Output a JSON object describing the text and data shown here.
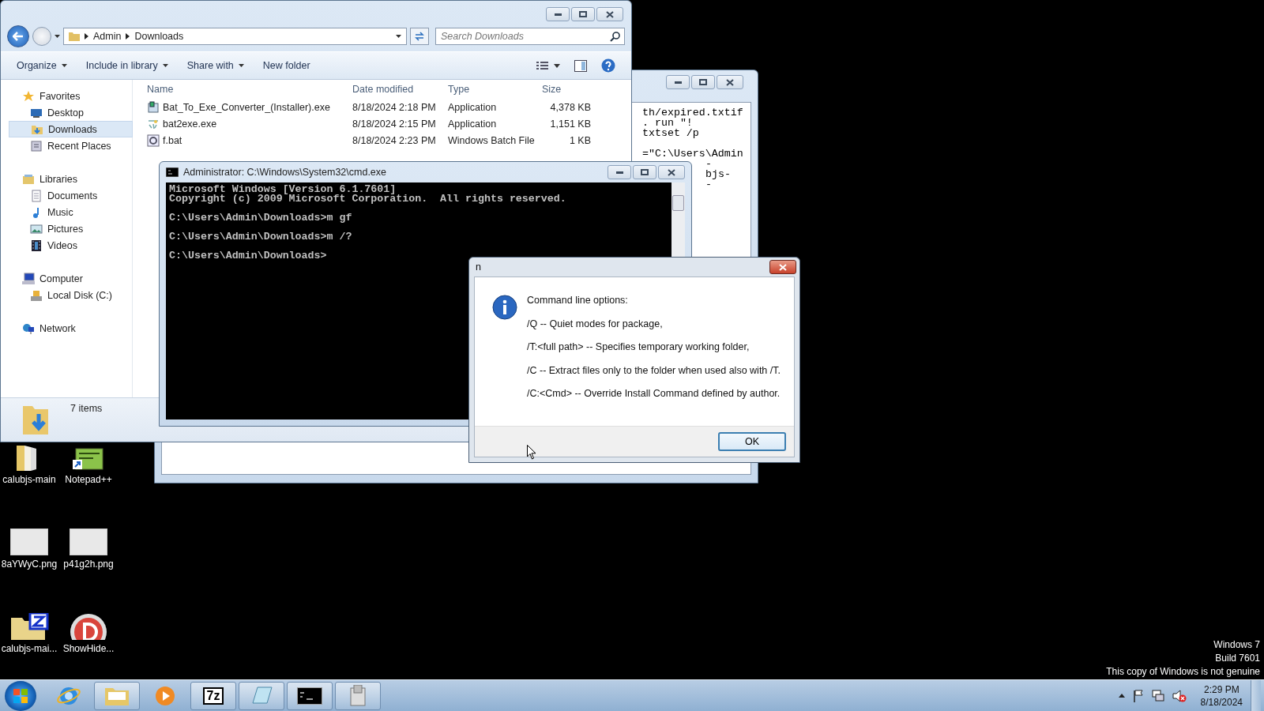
{
  "explorer": {
    "breadcrumb": [
      "Admin",
      "Downloads"
    ],
    "search": {
      "placeholder": "Search Downloads"
    },
    "toolbar": [
      {
        "label": "Organize",
        "menu": true
      },
      {
        "label": "Include in library",
        "menu": true
      },
      {
        "label": "Share with",
        "menu": true
      },
      {
        "label": "New folder",
        "menu": false
      }
    ],
    "columns": [
      "Name",
      "Date modified",
      "Type",
      "Size"
    ],
    "files": [
      {
        "kind": "installer",
        "name": "Bat_To_Exe_Converter_(Installer).exe",
        "date": "8/18/2024 2:18 PM",
        "type": "Application",
        "size": "4,378 KB"
      },
      {
        "kind": "app",
        "name": "bat2exe.exe",
        "date": "8/18/2024 2:15 PM",
        "type": "Application",
        "size": "1,151 KB"
      },
      {
        "kind": "batch",
        "name": "f.bat",
        "date": "8/18/2024 2:23 PM",
        "type": "Windows Batch File",
        "size": "1 KB"
      }
    ],
    "sidebar": [
      {
        "kind": "favorites",
        "label": "Favorites",
        "selected": false,
        "children": [
          {
            "kind": "desktop",
            "label": "Desktop",
            "selected": false
          },
          {
            "kind": "downloads",
            "label": "Downloads",
            "selected": true
          },
          {
            "kind": "recent",
            "label": "Recent Places",
            "selected": false
          }
        ]
      },
      {
        "kind": "libraries",
        "label": "Libraries",
        "selected": false,
        "children": [
          {
            "kind": "documents",
            "label": "Documents",
            "selected": false
          },
          {
            "kind": "music",
            "label": "Music",
            "selected": false
          },
          {
            "kind": "pictures",
            "label": "Pictures",
            "selected": false
          },
          {
            "kind": "videos",
            "label": "Videos",
            "selected": false
          }
        ]
      },
      {
        "kind": "computer",
        "label": "Computer",
        "selected": false,
        "children": [
          {
            "kind": "disk",
            "label": "Local Disk (C:)",
            "selected": false
          }
        ]
      },
      {
        "kind": "network",
        "label": "Network",
        "selected": false
      }
    ],
    "status": "7 items"
  },
  "back_window": {
    "blocks": [
      {
        "kind": "full",
        "lines": [
          "th/expired.txtif",
          ". run \"!",
          "txtset /p"
        ]
      },
      {
        "kind": "full",
        "lines": [
          "=\"C:\\Users\\Admin"
        ]
      },
      {
        "kind": "tail",
        "lines": [
          "-",
          "bjs-",
          "-"
        ]
      }
    ]
  },
  "cmd": {
    "title": "Administrator: C:\\Windows\\System32\\cmd.exe",
    "blocks": [
      [
        "Microsoft Windows [Version 6.1.7601]",
        "Copyright (c) 2009 Microsoft Corporation.  All rights reserved."
      ],
      [
        "C:\\Users\\Admin\\Downloads>m gf"
      ],
      [
        "C:\\Users\\Admin\\Downloads>m /?"
      ],
      [
        "C:\\Users\\Admin\\Downloads>"
      ]
    ]
  },
  "dialog": {
    "title": "n",
    "heading": "Command line options:",
    "options": [
      "/Q -- Quiet modes for package,",
      "/T:<full path> -- Specifies temporary working folder,",
      "/C -- Extract files only to the folder when used also with /T.",
      "/C:<Cmd> -- Override Install Command defined by author."
    ],
    "button": "OK"
  },
  "desktop_icons": [
    {
      "kind": "folder",
      "label": "calubjs-main"
    },
    {
      "kind": "shortcut",
      "label": "Notepad++"
    },
    {
      "kind": "image",
      "label": "8aYWyC.png"
    },
    {
      "kind": "image",
      "label": "p41g2h.png"
    },
    {
      "kind": "zip",
      "label": "calubjs-mai..."
    },
    {
      "kind": "badge",
      "label": "ShowHide..."
    }
  ],
  "os_notice": [
    "Windows 7",
    "Build 7601",
    "This copy of Windows is not genuine"
  ],
  "taskbar": {
    "buttons": [
      {
        "kind": "browser",
        "active": false
      },
      {
        "kind": "folder",
        "active": true
      },
      {
        "kind": "media",
        "active": false
      },
      {
        "kind": "archive",
        "label": "7z",
        "active": true
      },
      {
        "kind": "notepad",
        "active": true
      },
      {
        "kind": "console",
        "active": true
      },
      {
        "kind": "installer",
        "active": true
      }
    ],
    "clock": {
      "time": "2:29 PM",
      "date": "8/18/2024"
    }
  }
}
